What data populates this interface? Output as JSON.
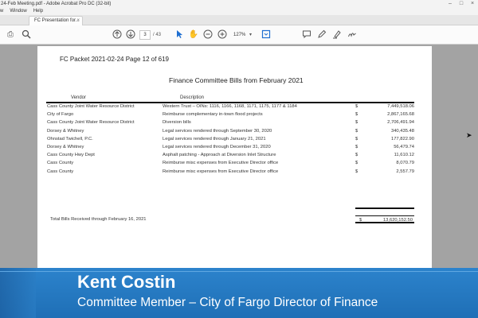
{
  "window": {
    "title": "24-Feb Meeting.pdf - Adobe Acrobat Pro DC (32-bit)",
    "controls": [
      "–",
      "□",
      "×"
    ]
  },
  "menu": [
    "w",
    "Window",
    "Help"
  ],
  "tab": {
    "label": "FC Presentation for...",
    "close": "×"
  },
  "toolbar": {
    "page_current": "3",
    "page_total": "/ 43",
    "zoom": "127%",
    "icons": [
      "print-icon",
      "zoom-search-icon",
      "prev-page-icon",
      "next-page-icon",
      "select-cursor-icon",
      "hand-icon",
      "zoom-out-icon",
      "zoom-in-icon",
      "fit-page-icon",
      "comment-icon",
      "pen-icon",
      "highlight-icon",
      "sign-icon"
    ]
  },
  "document": {
    "packet": "FC Packet 2021-02-24 Page 12 of 619",
    "title": "Finance Committee Bills from February 2021",
    "columns": {
      "vendor": "Vendor",
      "description": "Description"
    },
    "rows": [
      {
        "vendor": "Cass County Joint Water Resource District",
        "description": "Western Trust – OINs: 1116, 1166, 1168, 1171, 1175, 1177 & 1184",
        "currency": "$",
        "amount": "7,449,518.06"
      },
      {
        "vendor": "City of Fargo",
        "description": "Reimburse complementary in-town flood projects",
        "currency": "$",
        "amount": "2,867,165.68"
      },
      {
        "vendor": "Cass County Joint Water Resource District",
        "description": "Diversion bills",
        "currency": "$",
        "amount": "2,706,491.94"
      },
      {
        "vendor": "Dorsey & Whitney",
        "description": "Legal services rendered through September 30, 2020",
        "currency": "$",
        "amount": "340,435.48"
      },
      {
        "vendor": "Ohnstad Twichell, P.C.",
        "description": "Legal services rendered through January 21, 2021",
        "currency": "$",
        "amount": "177,822.90"
      },
      {
        "vendor": "Dorsey & Whitney",
        "description": "Legal services rendered through December 31, 2020",
        "currency": "$",
        "amount": "56,479.74"
      },
      {
        "vendor": "Cass County Hwy Dept",
        "description": "Asphalt patching - Approach at Diversion Inlet Structure",
        "currency": "$",
        "amount": "11,610.12"
      },
      {
        "vendor": "Cass County",
        "description": "Reimburse misc expenses from Executive Director office",
        "currency": "$",
        "amount": "8,070.79"
      },
      {
        "vendor": "Cass County",
        "description": "Reimburse misc expenses from Executive Director office",
        "currency": "$",
        "amount": "2,557.79"
      }
    ],
    "total_label": "Total Bills Received through February 16, 2021",
    "total_currency": "$",
    "total_amount": "13,620,152.50"
  },
  "lower_third": {
    "name": "Kent Costin",
    "role": "Committee Member – City of Fargo Director of Finance"
  }
}
